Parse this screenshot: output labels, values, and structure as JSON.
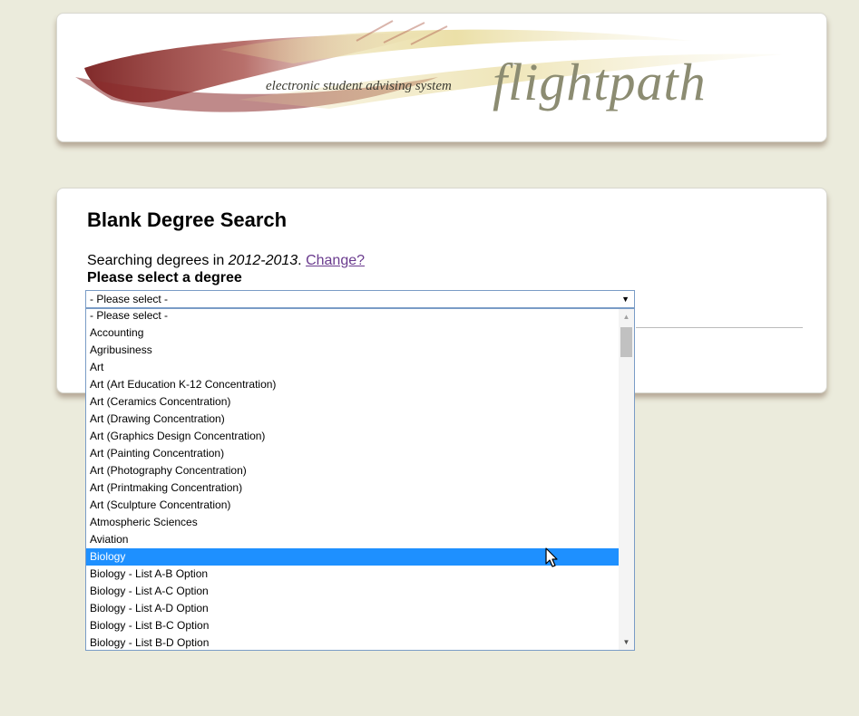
{
  "header": {
    "tagline": "electronic student advising system",
    "logo_word": "flightpath"
  },
  "content": {
    "title": "Blank Degree Search",
    "searching_prefix": "Searching degrees in ",
    "year": "2012-2013",
    "year_suffix": ". ",
    "change_link": "Change?",
    "select_label": "Please select a degree"
  },
  "degree_select": {
    "selected_value": "- Please select -",
    "options": [
      "- Please select -",
      "Accounting",
      "Agribusiness",
      "Art",
      "Art (Art Education K-12 Concentration)",
      "Art (Ceramics Concentration)",
      "Art (Drawing Concentration)",
      "Art (Graphics Design Concentration)",
      "Art (Painting Concentration)",
      "Art (Photography Concentration)",
      "Art (Printmaking Concentration)",
      "Art (Sculpture Concentration)",
      "Atmospheric Sciences",
      "Aviation",
      "Biology",
      "Biology - List A-B Option",
      "Biology - List A-C Option",
      "Biology - List A-D Option",
      "Biology - List B-C Option",
      "Biology - List B-D Option"
    ],
    "highlighted_index": 14
  },
  "colors": {
    "page_bg": "#ebebdc",
    "highlight": "#1e90ff",
    "link": "#6a3b8e",
    "logo_text": "#8c8c72",
    "swoosh_dark": "#7a1f1f"
  },
  "icons": {
    "dropdown_arrow": "triangle-down-icon",
    "cursor": "mouse-pointer-icon"
  }
}
